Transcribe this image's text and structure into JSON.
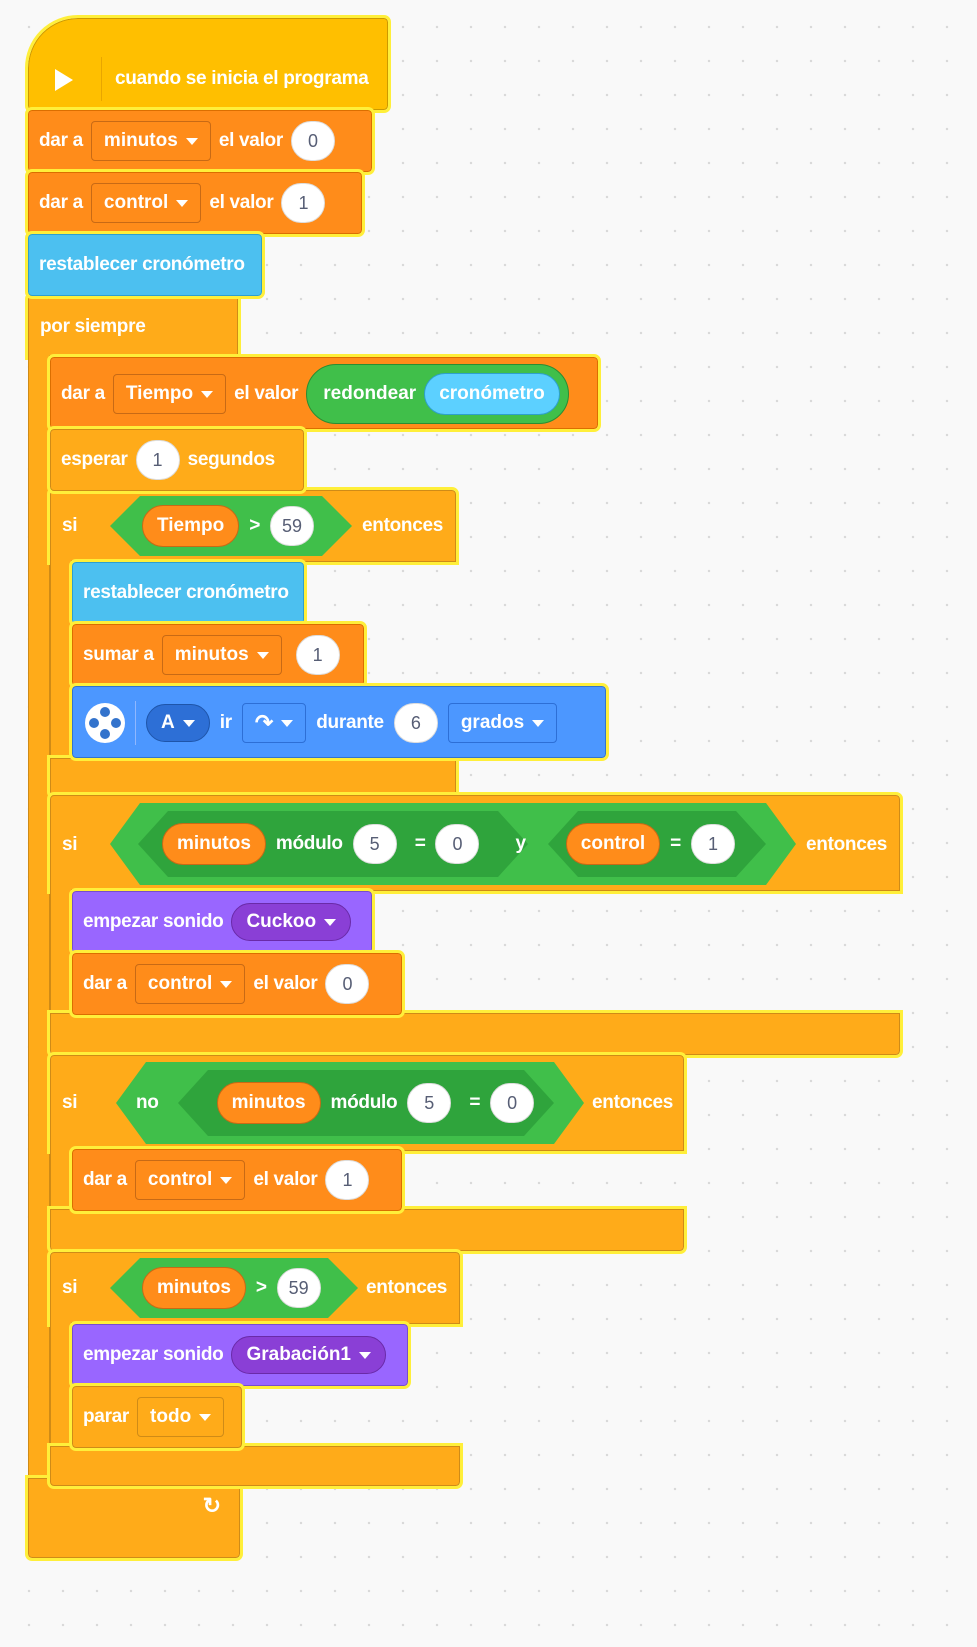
{
  "hat": {
    "label": "cuando se inicia el programa"
  },
  "init": [
    {
      "prefix": "dar a",
      "var": "minutos",
      "mid": "el valor",
      "value": "0"
    },
    {
      "prefix": "dar a",
      "var": "control",
      "mid": "el valor",
      "value": "1"
    }
  ],
  "reset1": {
    "label": "restablecer cronómetro"
  },
  "forever": {
    "label": "por siempre"
  },
  "set_tiempo": {
    "prefix": "dar a",
    "var": "Tiempo",
    "mid": "el valor",
    "round": "redondear",
    "timer": "cronómetro"
  },
  "wait": {
    "prefix": "esperar",
    "value": "1",
    "suffix": "segundos"
  },
  "if1": {
    "si": "si",
    "var": "Tiempo",
    "op": ">",
    "value": "59",
    "then": "entonces"
  },
  "reset2": {
    "label": "restablecer cronómetro"
  },
  "add": {
    "prefix": "sumar a",
    "var": "minutos",
    "value": "1"
  },
  "motor": {
    "port": "A",
    "go": "ir",
    "durante": "durante",
    "value": "6",
    "unit": "grados"
  },
  "if2": {
    "si": "si",
    "var": "minutos",
    "mod": "módulo",
    "mod_value": "5",
    "eq": "=",
    "eq_value": "0",
    "and": "y",
    "var2": "control",
    "eq2": "=",
    "value2": "1",
    "then": "entonces"
  },
  "sound1": {
    "prefix": "empezar sonido",
    "sound": "Cuckoo"
  },
  "set_ctrl0": {
    "prefix": "dar a",
    "var": "control",
    "mid": "el valor",
    "value": "0"
  },
  "if3": {
    "si": "si",
    "not": "no",
    "var": "minutos",
    "mod": "módulo",
    "mod_value": "5",
    "eq": "=",
    "eq_value": "0",
    "then": "entonces"
  },
  "set_ctrl1": {
    "prefix": "dar a",
    "var": "control",
    "mid": "el valor",
    "value": "1"
  },
  "if4": {
    "si": "si",
    "var": "minutos",
    "op": ">",
    "value": "59",
    "then": "entonces"
  },
  "sound2": {
    "prefix": "empezar sonido",
    "sound": "Grabación1"
  },
  "stop": {
    "prefix": "parar",
    "option": "todo"
  },
  "colors": {
    "variables": "#ff8c1a",
    "control": "#ffab19",
    "events": "#ffbf00",
    "sensing": "#4cc0f0",
    "motors": "#4c97ff",
    "sound": "#9966ff",
    "operators": "#40bf4a",
    "highlight": "#ffef3a"
  }
}
